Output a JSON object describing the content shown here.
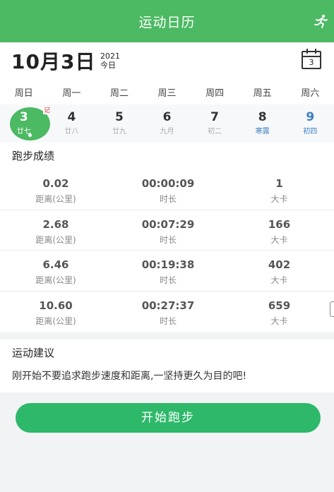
{
  "header": {
    "title": "运动日历",
    "runner_icon": "runner-icon"
  },
  "date": {
    "big": "10月3日",
    "year": "2021",
    "today": "今日",
    "calendar_num": "3"
  },
  "weekdays": [
    "周日",
    "周一",
    "周二",
    "周三",
    "周四",
    "周五",
    "周六"
  ],
  "days": [
    {
      "num": "3",
      "lunar": "廿七",
      "note": "记"
    },
    {
      "num": "4",
      "lunar": "廿八"
    },
    {
      "num": "5",
      "lunar": "廿九"
    },
    {
      "num": "6",
      "lunar": "九月"
    },
    {
      "num": "7",
      "lunar": "初二"
    },
    {
      "num": "8",
      "lunar": "寒露"
    },
    {
      "num": "9",
      "lunar": "初四"
    }
  ],
  "results": {
    "title": "跑步成绩",
    "rows": [
      {
        "distance": "0.02",
        "distance_label": "距离(公里)",
        "duration": "00:00:09",
        "duration_label": "时长",
        "calories": "1",
        "calories_label": "大卡"
      },
      {
        "distance": "2.68",
        "distance_label": "距离(公里)",
        "duration": "00:07:29",
        "duration_label": "时长",
        "calories": "166",
        "calories_label": "大卡"
      },
      {
        "distance": "6.46",
        "distance_label": "距离(公里)",
        "duration": "00:19:38",
        "duration_label": "时长",
        "calories": "402",
        "calories_label": "大卡"
      },
      {
        "distance": "10.60",
        "distance_label": "距离(公里)",
        "duration": "00:27:37",
        "duration_label": "时长",
        "calories": "659",
        "calories_label": "大卡"
      }
    ]
  },
  "advice": {
    "title": "运动建议",
    "body": "刚开始不要追求跑步速度和距离,一坚持更久为目的吧!"
  },
  "start_button": "开始跑步",
  "colors": {
    "primary_green": "#4cb963",
    "button_green": "#2db86a",
    "accent_blue": "#3a7fc1",
    "note_red": "#dd2222"
  }
}
